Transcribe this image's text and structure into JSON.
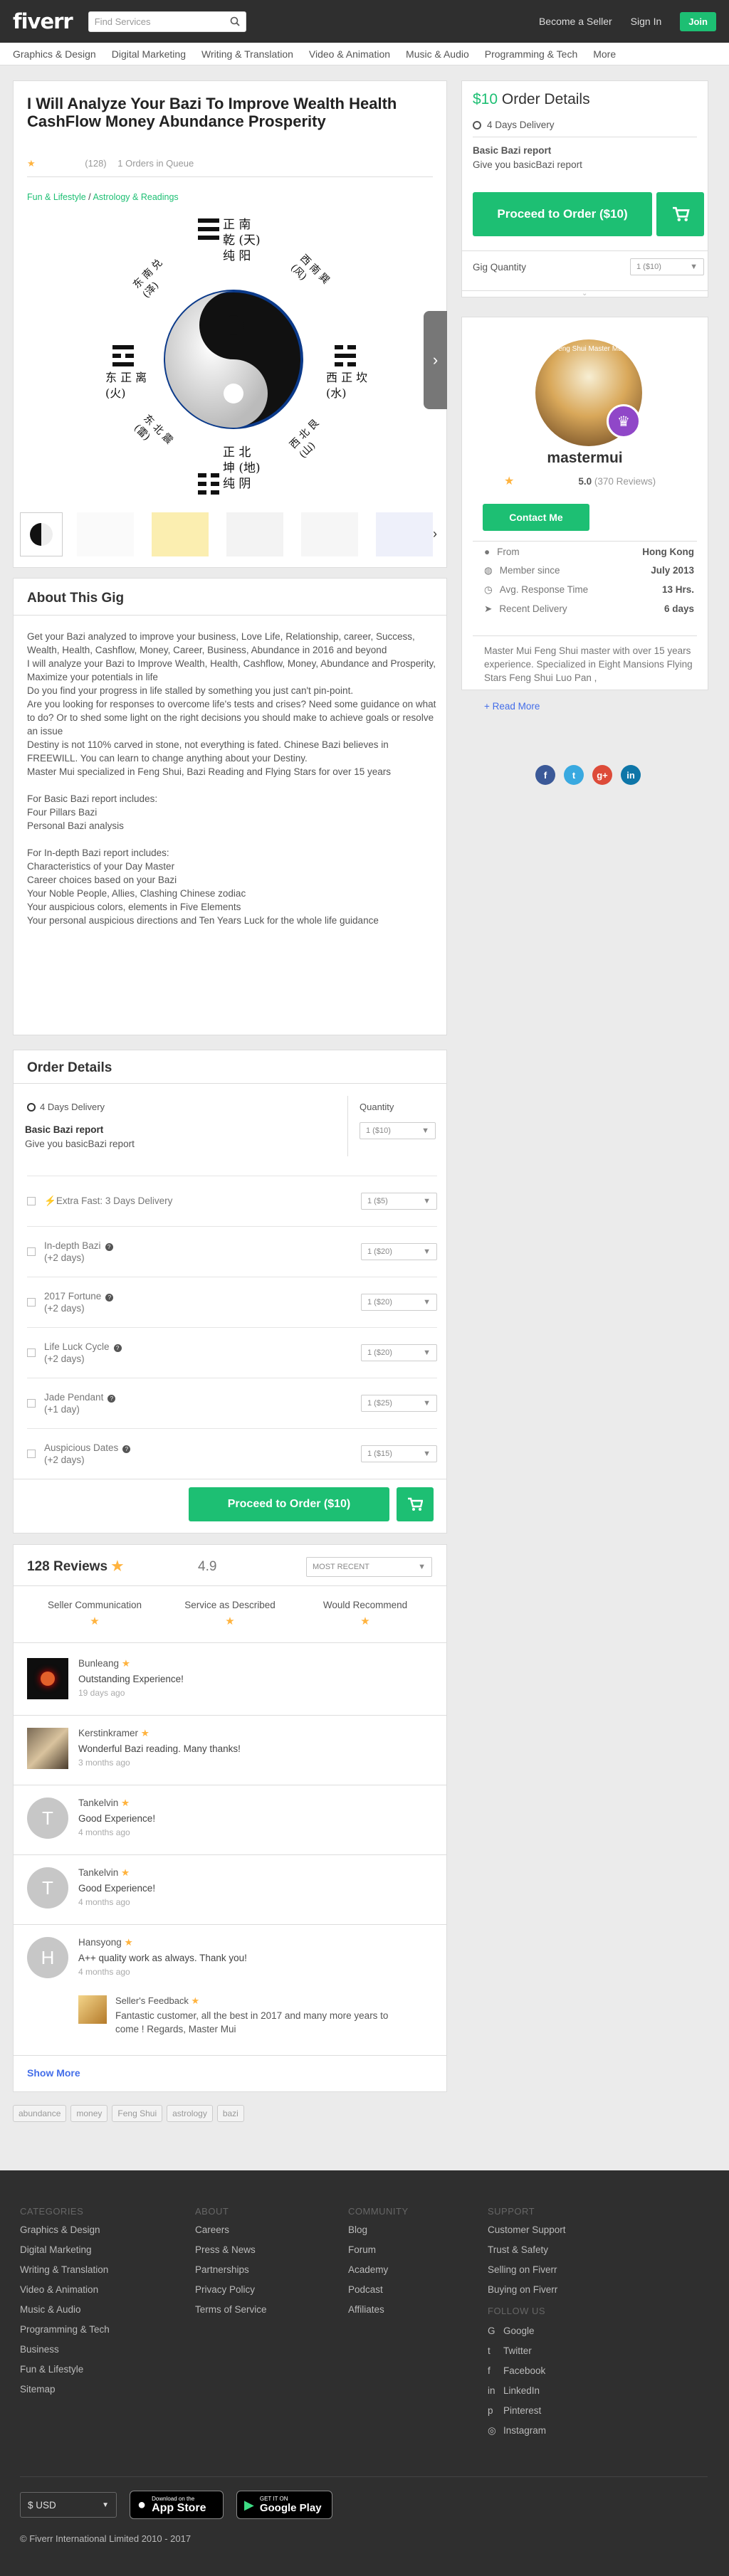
{
  "header": {
    "logo": "fiverr",
    "search_placeholder": "Find Services",
    "become_seller": "Become a Seller",
    "sign_in": "Sign In",
    "join": "Join"
  },
  "categories": [
    "Graphics & Design",
    "Digital Marketing",
    "Writing & Translation",
    "Video & Animation",
    "Music & Audio",
    "Programming & Tech",
    "More"
  ],
  "gig": {
    "title": "I Will Analyze Your Bazi To Improve Wealth Health CashFlow Money Abundance Prosperity",
    "rating_count": "(128)",
    "queue": "1 Orders in Queue",
    "breadcrumb": {
      "parent": "Fun & Lifestyle",
      "sep": "/",
      "child": "Astrology & Readings"
    },
    "image_text": {
      "top": "正 南 乾 (天) 纯 阳",
      "left": "东 正 离 (火)",
      "right": "西 正 坎 (水)",
      "bottom": "正 北 坤 (地) 纯 阴",
      "nw": "东 南 兑 (泽)",
      "ne": "西 南 巽 (风)",
      "sw": "东 北 震 (雷)",
      "se": "西 北 艮 (山)"
    }
  },
  "about": {
    "heading": "About This Gig",
    "paragraphs": [
      "Get your Bazi analyzed to improve your business, Love  Life, Relationship, career, Success, Wealth, Health, Cashflow, Money, Career, Business, Abundance in 2016 and beyond",
      "I will analyze your Bazi to Improve Wealth, Health, Cashflow, Money, Abundance and Prosperity, Maximize your potentials in life",
      "Do you find your progress in life stalled by something you just can't pin-point.",
      "Are you looking for responses to overcome life's tests and crises? Need some guidance on what to do? Or to shed some light on the right decisions you should make to achieve goals or resolve an issue",
      "Destiny is not 110% carved in stone, not everything is fated. Chinese Bazi believes in FREEWILL. You can learn to change anything about your Destiny.",
      "Master Mui specialized in  Feng Shui, Bazi Reading and Flying Stars for over 15 years",
      "",
      "For Basic Bazi report includes:",
      "Four Pillars Bazi",
      "Personal Bazi analysis",
      "",
      "For In-depth Bazi report includes:",
      "Characteristics of your Day Master",
      "Career choices based on your Bazi",
      "Your Noble People, Allies, Clashing Chinese zodiac",
      "Your auspicious colors, elements in Five Elements",
      "Your personal auspicious directions and Ten Years Luck for the whole life guidance"
    ]
  },
  "order": {
    "heading": "Order Details",
    "delivery": "4 Days Delivery",
    "quantity_label": "Quantity",
    "quantity_value": "1 ($10)",
    "package": "Basic Bazi report",
    "package_desc": "Give you basicBazi report",
    "extras": [
      {
        "label": "Extra Fast: 3 Days Delivery",
        "sub": "",
        "qty": "1 ($5)"
      },
      {
        "label": "In-depth Bazi",
        "sub": "(+2 days)",
        "qty": "1 ($20)"
      },
      {
        "label": "2017 Fortune",
        "sub": "(+2 days)",
        "qty": "1 ($20)"
      },
      {
        "label": "Life Luck Cycle",
        "sub": "(+2 days)",
        "qty": "1 ($20)"
      },
      {
        "label": "Jade Pendant",
        "sub": "(+1 day)",
        "qty": "1 ($25)"
      },
      {
        "label": "Auspicious Dates",
        "sub": "(+2 days)",
        "qty": "1 ($15)"
      }
    ],
    "proceed": "Proceed to Order ($10)"
  },
  "reviews": {
    "heading": "128 Reviews",
    "score": "4.9",
    "sort": "MOST RECENT",
    "criteria": [
      "Seller Communication",
      "Service as Described",
      "Would Recommend"
    ],
    "items": [
      {
        "name": "Bunleang",
        "text": "Outstanding Experience!",
        "time": "19 days ago",
        "initial": ""
      },
      {
        "name": "Kerstinkramer",
        "text": "Wonderful Bazi reading. Many thanks!",
        "time": "3 months ago",
        "initial": ""
      },
      {
        "name": "Tankelvin",
        "text": "Good Experience!",
        "time": "4 months ago",
        "initial": "T"
      },
      {
        "name": "Tankelvin",
        "text": "Good Experience!",
        "time": "4 months ago",
        "initial": "T"
      },
      {
        "name": "Hansyong",
        "text": "A++ quality work as always. Thank you!",
        "time": "4 months ago",
        "initial": "H"
      }
    ],
    "seller_feedback_label": "Seller's Feedback",
    "seller_feedback": "Fantastic customer, all the best in 2017 and many more years to come ! Regards, Master Mui",
    "show_more": "Show More"
  },
  "tags": [
    "abundance",
    "money",
    "Feng Shui",
    "astrology",
    "bazi"
  ],
  "sidebar": {
    "price": "$10",
    "title": "Order Details",
    "delivery": "4 Days Delivery",
    "package": "Basic Bazi report",
    "package_desc": "Give you basicBazi report",
    "proceed": "Proceed to Order ($10)",
    "qty_label": "Gig Quantity",
    "qty_value": "1 ($10)"
  },
  "seller": {
    "avatar_caption": "Feng Shui Master Mui",
    "username": "mastermui",
    "rating": "5.0",
    "reviews": "(370 Reviews)",
    "contact": "Contact Me",
    "details": [
      {
        "k": "From",
        "v": "Hong Kong"
      },
      {
        "k": "Member since",
        "v": "July 2013"
      },
      {
        "k": "Avg. Response Time",
        "v": "13 Hrs."
      },
      {
        "k": "Recent Delivery",
        "v": "6 days"
      }
    ],
    "bio": "Master Mui Feng Shui master with over 15 years experience. Specialized in Eight Mansions Flying Stars Feng Shui Luo Pan ,",
    "read_more": "+ Read More"
  },
  "share": {
    "fb": "f",
    "tw": "t",
    "gp": "g+",
    "li": "in"
  },
  "footer": {
    "categories_head": "Categories",
    "categories": [
      "Graphics & Design",
      "Digital Marketing",
      "Writing & Translation",
      "Video & Animation",
      "Music & Audio",
      "Programming & Tech",
      "Business",
      "Fun & Lifestyle",
      "Sitemap"
    ],
    "about_head": "About",
    "about": [
      "Careers",
      "Press & News",
      "Partnerships",
      "Privacy Policy",
      "Terms of Service"
    ],
    "community_head": "Community",
    "community": [
      "Blog",
      "Forum",
      "Academy",
      "Podcast",
      "Affiliates"
    ],
    "support_head": "Support",
    "support": [
      "Customer Support",
      "Trust & Safety",
      "Selling on Fiverr",
      "Buying on Fiverr"
    ],
    "follow_head": "Follow Us",
    "follow": [
      "Google",
      "Twitter",
      "Facebook",
      "LinkedIn",
      "Pinterest",
      "Instagram"
    ],
    "currency": "$ USD",
    "appstore_small": "Download on the",
    "appstore": "App Store",
    "gplay_small": "GET IT ON",
    "gplay": "Google Play",
    "copyright": "© Fiverr International Limited 2010 - 2017"
  },
  "colors": {
    "green": "#1dbf73",
    "dark": "#2f2f2f",
    "star": "#ffb33e",
    "link": "#446ee9"
  }
}
